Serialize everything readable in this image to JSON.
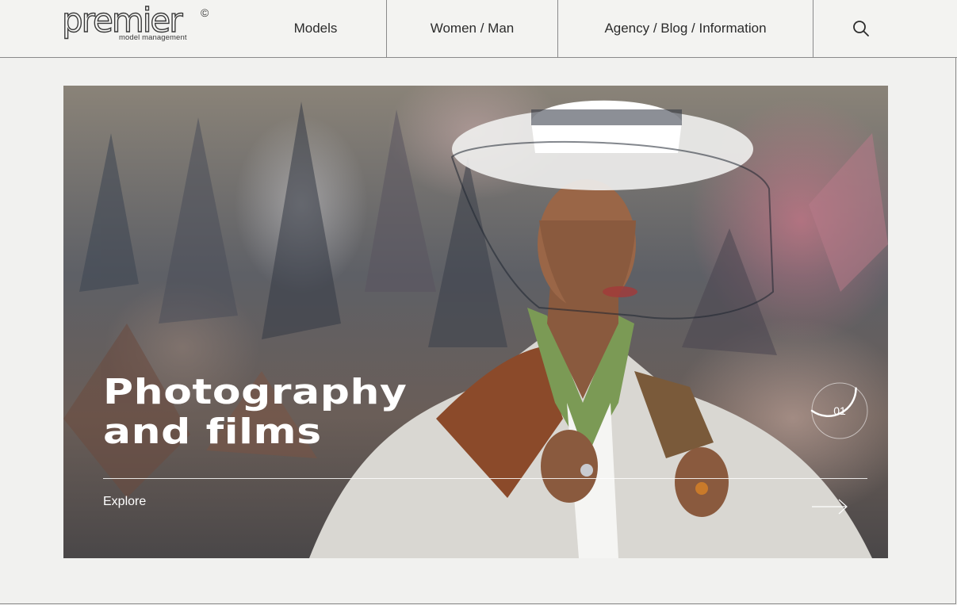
{
  "header": {
    "logo": {
      "wordmark": "premier",
      "copyright_mark": "©",
      "tagline": "model management"
    },
    "nav": [
      {
        "label": "Models"
      },
      {
        "label": "Women / Man"
      },
      {
        "label": "Agency / Blog / Information"
      }
    ],
    "search_icon": "search-icon"
  },
  "hero": {
    "title_line1": "Photography",
    "title_line2": "and films",
    "explore_label": "Explore",
    "slide_number": "01",
    "slide_progress": 0.35,
    "arrow_icon": "arrow-right-icon"
  },
  "colors": {
    "background": "#f1f1ef",
    "divider": "#8a8a8a",
    "hero_text": "#ffffff"
  }
}
